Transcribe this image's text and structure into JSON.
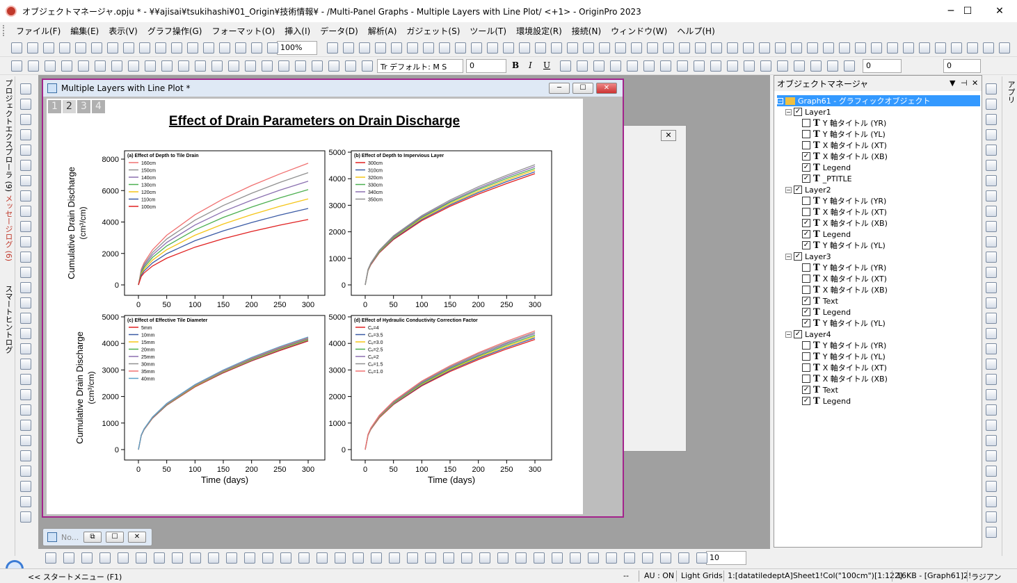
{
  "window": {
    "title": "オブジェクトマネージャ.opju * - ¥¥ajisai¥tsukihashi¥01_Origin¥技術情報¥ - /Multi-Panel Graphs - Multiple Layers with Line Plot/ <+1> - OriginPro 2023",
    "minimize": "─",
    "maximize": "☐",
    "close": "✕"
  },
  "menu": [
    "ファイル(F)",
    "編集(E)",
    "表示(V)",
    "グラフ操作(G)",
    "フォーマット(O)",
    "挿入(I)",
    "データ(D)",
    "解析(A)",
    "ガジェット(S)",
    "ツール(T)",
    "環境設定(R)",
    "接続(N)",
    "ウィンドウ(W)",
    "ヘルプ(H)"
  ],
  "toolbar": {
    "zoom": "100%",
    "font": "Tr デフォルト: M S",
    "font_size": "0",
    "line_width": "0",
    "line_size": "0",
    "bold": "B",
    "italic": "I",
    "underline": "U",
    "bottom_size": "10"
  },
  "left_tabs": [
    "プロジェクトエクスプローラ (9)",
    "メッセージログ (6)",
    "スマートヒントログ"
  ],
  "right_tab": "アプリ",
  "graph_window": {
    "title": "Multiple Layers with Line Plot *",
    "layer_tabs": [
      "1",
      "2",
      "3",
      "4"
    ],
    "active_layer": 1
  },
  "minimized_window": {
    "title": "No..."
  },
  "chart_data": [
    {
      "type": "line",
      "title": "Effect of Drain Parameters on Drain Discharge",
      "panel_title": "(a) Effect of Depth to Tile Drain",
      "xlabel": "",
      "ylabel": "Cumulative Drain Discharge (cm³/cm)",
      "xlim": [
        0,
        300
      ],
      "ylim": [
        0,
        8000
      ],
      "xticks": [
        0,
        50,
        100,
        150,
        200,
        250,
        300
      ],
      "yticks": [
        0,
        2000,
        4000,
        6000,
        8000
      ],
      "x": [
        0,
        5,
        10,
        25,
        50,
        100,
        150,
        200,
        250,
        300
      ],
      "series": [
        {
          "name": "160cm",
          "color": "#f07070",
          "values": [
            0,
            1000,
            1410,
            2230,
            3160,
            4460,
            5470,
            6320,
            7060,
            7740
          ]
        },
        {
          "name": "150cm",
          "color": "#909090",
          "values": [
            0,
            920,
            1300,
            2060,
            2920,
            4120,
            5050,
            5830,
            6520,
            7140
          ]
        },
        {
          "name": "140cm",
          "color": "#8a6fb0",
          "values": [
            0,
            850,
            1210,
            1910,
            2700,
            3810,
            4670,
            5390,
            6030,
            6600
          ]
        },
        {
          "name": "130cm",
          "color": "#4caf50",
          "values": [
            0,
            780,
            1110,
            1750,
            2480,
            3500,
            4290,
            4950,
            5540,
            6060
          ]
        },
        {
          "name": "120cm",
          "color": "#f5c518",
          "values": [
            0,
            710,
            1000,
            1580,
            2240,
            3160,
            3870,
            4470,
            5000,
            5470
          ]
        },
        {
          "name": "110cm",
          "color": "#3b5ba5",
          "values": [
            0,
            630,
            890,
            1400,
            1990,
            2810,
            3440,
            3970,
            4440,
            4860
          ]
        },
        {
          "name": "100cm",
          "color": "#e02020",
          "values": [
            0,
            540,
            760,
            1200,
            1700,
            2400,
            2940,
            3400,
            3800,
            4160
          ]
        }
      ]
    },
    {
      "type": "line",
      "panel_title": "(b) Effect of Depth to Impervious Layer",
      "xlim": [
        0,
        300
      ],
      "ylim": [
        0,
        5000
      ],
      "xticks": [
        0,
        50,
        100,
        150,
        200,
        250,
        300
      ],
      "yticks": [
        0,
        1000,
        2000,
        3000,
        4000,
        5000
      ],
      "x": [
        0,
        5,
        10,
        25,
        50,
        100,
        150,
        200,
        250,
        300
      ],
      "series": [
        {
          "name": "300cm",
          "color": "#e02020",
          "values": [
            0,
            540,
            760,
            1210,
            1710,
            2420,
            2960,
            3420,
            3820,
            4190
          ]
        },
        {
          "name": "310cm",
          "color": "#3b5ba5",
          "values": [
            0,
            550,
            780,
            1230,
            1740,
            2460,
            3010,
            3480,
            3890,
            4260
          ]
        },
        {
          "name": "320cm",
          "color": "#f5c518",
          "values": [
            0,
            560,
            790,
            1250,
            1770,
            2500,
            3060,
            3530,
            3950,
            4330
          ]
        },
        {
          "name": "330cm",
          "color": "#4caf50",
          "values": [
            0,
            570,
            800,
            1270,
            1790,
            2540,
            3110,
            3590,
            4010,
            4390
          ]
        },
        {
          "name": "340cm",
          "color": "#8a6fb0",
          "values": [
            0,
            580,
            810,
            1290,
            1820,
            2570,
            3150,
            3640,
            4070,
            4460
          ]
        },
        {
          "name": "350cm",
          "color": "#909090",
          "values": [
            0,
            590,
            830,
            1310,
            1850,
            2610,
            3200,
            3700,
            4130,
            4530
          ]
        }
      ]
    },
    {
      "type": "line",
      "panel_title": "(c) Effect of Effective Tile Diameter",
      "xlabel": "Time (days)",
      "ylabel": "Cumulative Drain Discharge (cm³/cm)",
      "xlim": [
        0,
        300
      ],
      "ylim": [
        0,
        5000
      ],
      "xticks": [
        0,
        50,
        100,
        150,
        200,
        250,
        300
      ],
      "yticks": [
        0,
        1000,
        2000,
        3000,
        4000,
        5000
      ],
      "x": [
        0,
        5,
        10,
        25,
        50,
        100,
        150,
        200,
        250,
        300
      ],
      "series": [
        {
          "name": "5mm",
          "color": "#e02020",
          "values": [
            0,
            530,
            750,
            1180,
            1670,
            2360,
            2890,
            3340,
            3730,
            4090
          ]
        },
        {
          "name": "10mm",
          "color": "#3b5ba5",
          "values": [
            0,
            534,
            755,
            1190,
            1680,
            2380,
            2910,
            3360,
            3760,
            4120
          ]
        },
        {
          "name": "15mm",
          "color": "#f5c518",
          "values": [
            0,
            537,
            760,
            1200,
            1690,
            2390,
            2930,
            3380,
            3780,
            4140
          ]
        },
        {
          "name": "20mm",
          "color": "#4caf50",
          "values": [
            0,
            540,
            764,
            1205,
            1700,
            2410,
            2950,
            3400,
            3800,
            4160
          ]
        },
        {
          "name": "25mm",
          "color": "#8a6fb0",
          "values": [
            0,
            543,
            768,
            1210,
            1710,
            2420,
            2960,
            3420,
            3820,
            4180
          ]
        },
        {
          "name": "30mm",
          "color": "#909090",
          "values": [
            0,
            546,
            772,
            1220,
            1720,
            2430,
            2980,
            3440,
            3840,
            4200
          ]
        },
        {
          "name": "35mm",
          "color": "#f07070",
          "values": [
            0,
            549,
            776,
            1225,
            1730,
            2440,
            2990,
            3450,
            3860,
            4220
          ]
        },
        {
          "name": "40mm",
          "color": "#5aa0c8",
          "values": [
            0,
            552,
            780,
            1230,
            1740,
            2450,
            3000,
            3470,
            3880,
            4240
          ]
        }
      ]
    },
    {
      "type": "line",
      "panel_title": "(d) Effect of Hydraulic Conductivity Correction Factor",
      "xlabel": "Time (days)",
      "xlim": [
        0,
        300
      ],
      "ylim": [
        0,
        5000
      ],
      "xticks": [
        0,
        50,
        100,
        150,
        200,
        250,
        300
      ],
      "yticks": [
        0,
        1000,
        2000,
        3000,
        4000,
        5000
      ],
      "x": [
        0,
        5,
        10,
        25,
        50,
        100,
        150,
        200,
        250,
        300
      ],
      "series": [
        {
          "name": "Cₑ=4",
          "color": "#e02020",
          "values": [
            0,
            540,
            760,
            1200,
            1700,
            2400,
            2940,
            3390,
            3790,
            4150
          ]
        },
        {
          "name": "Cₑ=3.5",
          "color": "#3b5ba5",
          "values": [
            0,
            545,
            770,
            1220,
            1720,
            2430,
            2980,
            3440,
            3840,
            4210
          ]
        },
        {
          "name": "Cₑ=3.0",
          "color": "#f5c518",
          "values": [
            0,
            551,
            779,
            1230,
            1740,
            2460,
            3010,
            3480,
            3890,
            4260
          ]
        },
        {
          "name": "Cₑ=2.5",
          "color": "#4caf50",
          "values": [
            0,
            557,
            788,
            1245,
            1760,
            2490,
            3050,
            3520,
            3940,
            4310
          ]
        },
        {
          "name": "Cₑ=2",
          "color": "#8a6fb0",
          "values": [
            0,
            563,
            797,
            1260,
            1780,
            2520,
            3090,
            3560,
            3990,
            4370
          ]
        },
        {
          "name": "Cₑ=1.5",
          "color": "#909090",
          "values": [
            0,
            570,
            806,
            1275,
            1800,
            2550,
            3120,
            3610,
            4030,
            4420
          ]
        },
        {
          "name": "Cₑ=1.0",
          "color": "#f07070",
          "values": [
            0,
            577,
            816,
            1290,
            1825,
            2580,
            3160,
            3650,
            4080,
            4470
          ]
        }
      ]
    }
  ],
  "object_manager": {
    "title": "オブジェクトマネージャ",
    "root": "Graph61 - グラフィックオブジェクト",
    "layers": [
      {
        "name": "Layer1",
        "checked": true,
        "items": [
          {
            "label": "Y 軸タイトル (YR)",
            "checked": false
          },
          {
            "label": "Y 軸タイトル (YL)",
            "checked": false
          },
          {
            "label": "X 軸タイトル (XT)",
            "checked": false
          },
          {
            "label": "X 軸タイトル (XB)",
            "checked": true
          },
          {
            "label": "Legend",
            "checked": true
          },
          {
            "label": "_PTITLE",
            "checked": true
          }
        ]
      },
      {
        "name": "Layer2",
        "checked": true,
        "items": [
          {
            "label": "Y 軸タイトル (YR)",
            "checked": false
          },
          {
            "label": "X 軸タイトル (XT)",
            "checked": false
          },
          {
            "label": "X 軸タイトル (XB)",
            "checked": true
          },
          {
            "label": "Legend",
            "checked": true
          },
          {
            "label": "Y 軸タイトル (YL)",
            "checked": true
          }
        ]
      },
      {
        "name": "Layer3",
        "checked": true,
        "items": [
          {
            "label": "Y 軸タイトル (YR)",
            "checked": false
          },
          {
            "label": "X 軸タイトル (XT)",
            "checked": false
          },
          {
            "label": "X 軸タイトル (XB)",
            "checked": false
          },
          {
            "label": "Text",
            "checked": true
          },
          {
            "label": "Legend",
            "checked": true
          },
          {
            "label": "Y 軸タイトル (YL)",
            "checked": true
          }
        ]
      },
      {
        "name": "Layer4",
        "checked": true,
        "items": [
          {
            "label": "Y 軸タイトル (YR)",
            "checked": false
          },
          {
            "label": "Y 軸タイトル (YL)",
            "checked": false
          },
          {
            "label": "X 軸タイトル (XT)",
            "checked": false
          },
          {
            "label": "X 軸タイトル (XB)",
            "checked": false
          },
          {
            "label": "Text",
            "checked": true
          },
          {
            "label": "Legend",
            "checked": true
          }
        ]
      }
    ]
  },
  "statusbar": {
    "start_menu": "<< スタートメニュー (F1)",
    "dashes": "--",
    "au": "AU : ON",
    "light_grids": "Light Grids",
    "col": "1:[datatiledeptA]Sheet1!Col(\"100cm\")[1:122]",
    "size": "16KB - [Graph61]2!",
    "unit": "ラジアン"
  }
}
